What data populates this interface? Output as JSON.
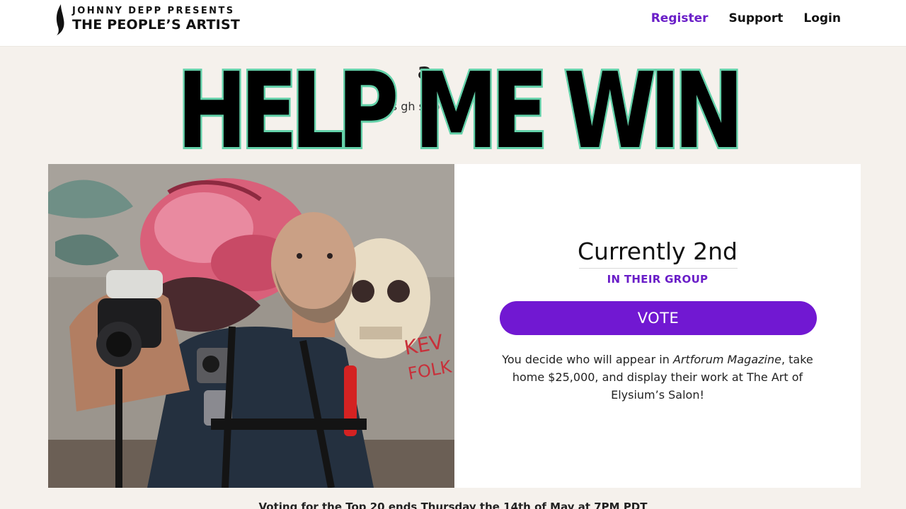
{
  "header": {
    "logo_line1": "JOHNNY DEPP PRESENTS",
    "logo_line2": "THE PEOPLE’S ARTIST",
    "nav": {
      "register": "Register",
      "support": "Support",
      "login": "Login"
    }
  },
  "page": {
    "title_visible": "a",
    "subtitle_visible": "ies  gh  st p"
  },
  "overlay_text": "HELP ME WIN",
  "card": {
    "rank": "Currently 2nd",
    "rank_sub": "IN THEIR GROUP",
    "vote_label": "VOTE",
    "desc_part1": "You decide who will appear in ",
    "desc_italic": "Artforum Magazine",
    "desc_part2": ", take home $25,000, and display their work at The Art of Elysium’s Salon!"
  },
  "footer_text": "Voting for the Top 20 ends Thursday the 14th of May at 7PM PDT",
  "colors": {
    "accent": "#7118d2",
    "overlay_fill": "#000000",
    "overlay_stroke": "#63d1a9",
    "background": "#f5f1ec"
  }
}
